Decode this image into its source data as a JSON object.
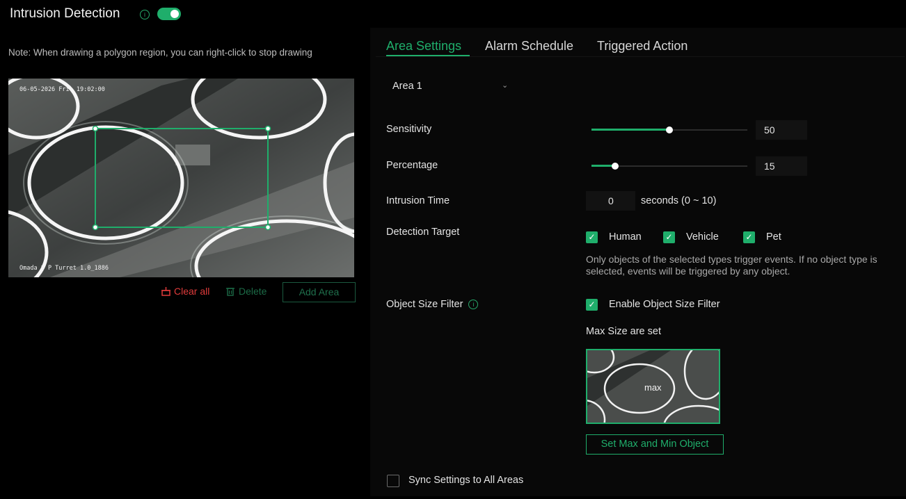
{
  "header": {
    "title": "Intrusion Detection",
    "info_icon": "info-icon",
    "toggle_on": true
  },
  "left": {
    "note": "Note: When drawing a polygon region, you can right-click to stop drawing",
    "video": {
      "timestamp": "06-05-2026 Fri. 19:02:00",
      "camera_name": "Omada 8 P Turret 1.0_1886"
    },
    "actions": {
      "clear_all": "Clear all",
      "delete": "Delete",
      "add_area": "Add Area"
    }
  },
  "tabs": [
    {
      "label": "Area Settings",
      "active": true
    },
    {
      "label": "Alarm Schedule",
      "active": false
    },
    {
      "label": "Triggered Action",
      "active": false
    }
  ],
  "area": {
    "selected": "Area 1"
  },
  "settings": {
    "sensitivity": {
      "label": "Sensitivity",
      "value": "50",
      "percent": 50
    },
    "percentage": {
      "label": "Percentage",
      "value": "15",
      "percent": 15
    },
    "intrusion_time": {
      "label": "Intrusion Time",
      "value": "0",
      "unit": "seconds (0 ~ 10)"
    },
    "detection_target": {
      "label": "Detection Target",
      "options": [
        {
          "label": "Human",
          "checked": true
        },
        {
          "label": "Vehicle",
          "checked": true
        },
        {
          "label": "Pet",
          "checked": true
        }
      ],
      "hint": "Only objects of the selected types trigger events. If no object type is selected, events will be triggered by any object."
    },
    "object_size_filter": {
      "label": "Object Size Filter",
      "enable_label": "Enable Object Size Filter",
      "enabled": true,
      "max_size_text": "Max Size are set",
      "thumb_label": "max",
      "set_button": "Set Max and Min Object"
    },
    "sync": {
      "label": "Sync Settings to All Areas",
      "checked": false
    }
  },
  "colors": {
    "accent": "#1fae6b",
    "danger": "#e03b3b",
    "background": "#000000"
  }
}
